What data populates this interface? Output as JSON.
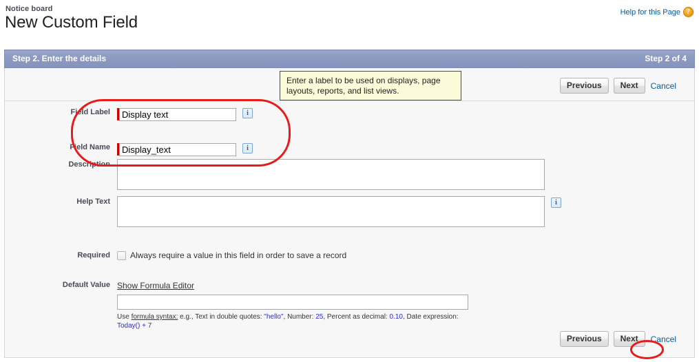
{
  "header": {
    "breadcrumb": "Notice board",
    "title": "New Custom Field",
    "help_link": "Help for this Page",
    "help_icon": "question-mark-icon"
  },
  "step_band": {
    "left_label": "Step 2. Enter the details",
    "right_label": "Step 2 of 4",
    "background_color": "#8c9ac1"
  },
  "buttons": {
    "previous": "Previous",
    "next": "Next",
    "cancel": "Cancel"
  },
  "tooltip": {
    "text": "Enter a label to be used on displays, page layouts, reports, and list views.",
    "background_color": "#fcfbd9"
  },
  "form": {
    "field_label": {
      "label": "Field Label",
      "value": "Display text",
      "required": true,
      "info_icon": "info-icon"
    },
    "field_name": {
      "label": "Field Name",
      "value": "Display_text",
      "required": true,
      "info_icon": "info-icon"
    },
    "description": {
      "label": "Description",
      "value": ""
    },
    "help_text": {
      "label": "Help Text",
      "value": "",
      "info_icon": "info-icon"
    },
    "required_row": {
      "label": "Required",
      "checkbox_label": "Always require a value in this field in order to save a record",
      "checked": false
    },
    "default_value": {
      "label": "Default Value",
      "formula_editor_link": "Show Formula Editor",
      "value": "",
      "hint": {
        "prefix": "Use ",
        "link": "formula syntax:",
        "mid1": " e.g., Text in double quotes: ",
        "lit1": "\"hello\"",
        "mid2": ", Number: ",
        "lit2": "25",
        "mid3": ", Percent as decimal: ",
        "lit3": "0.10",
        "mid4": ", Date expression: ",
        "lit4": "Today() + 7"
      }
    }
  },
  "annotations": {
    "color": "#e81b1b",
    "highlight_fields": "field-label-and-field-name",
    "highlight_button": "bottom-next-button"
  }
}
